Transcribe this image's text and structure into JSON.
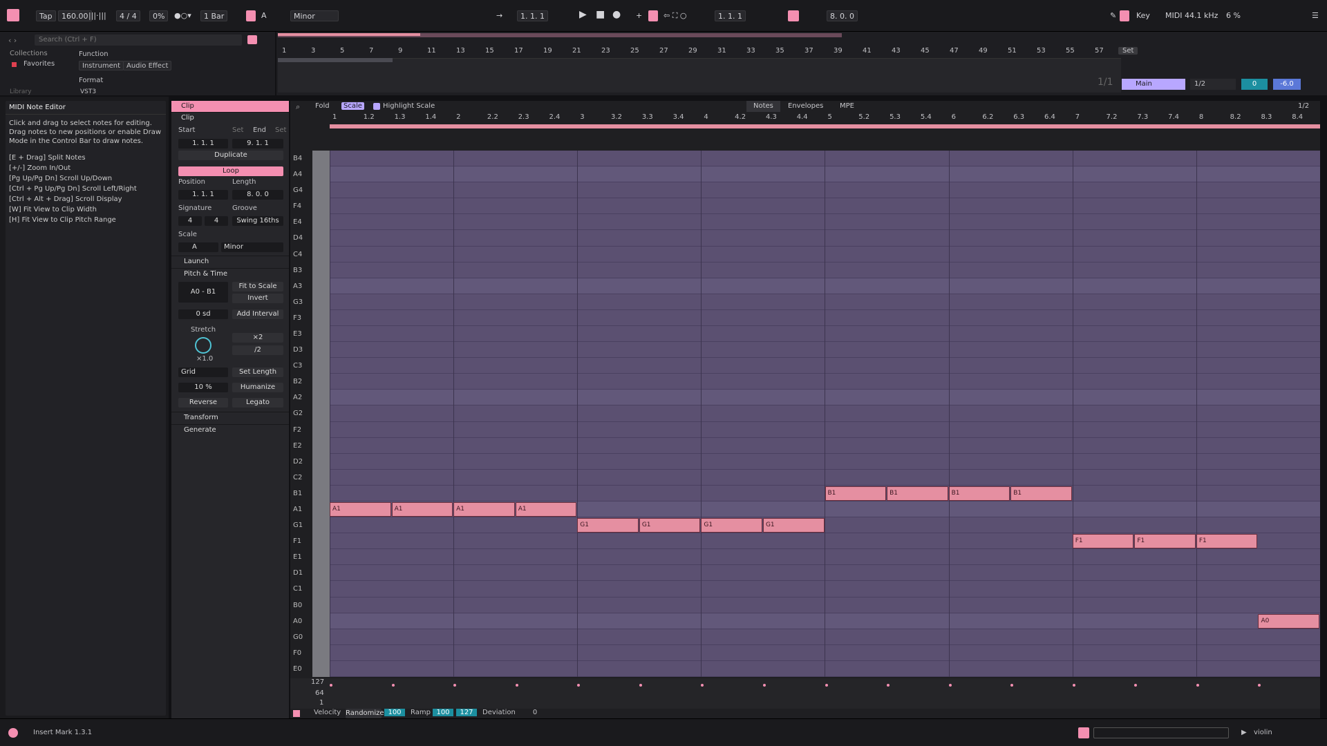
{
  "transport": {
    "tap": "Tap",
    "tempo": "160.00",
    "sig": "4 / 4",
    "swing": "0%",
    "quant": "1 Bar",
    "key": "A",
    "scale": "Minor",
    "pos": "1.  1.  1",
    "loop_start": "1.  1.  1",
    "loop_len": "8.  0.  0",
    "key_label": "Key",
    "midi_label": "MIDI",
    "sample_rate": "44.1 kHz",
    "cpu": "6 %"
  },
  "browser": {
    "search_placeholder": "Search (Ctrl + F)",
    "collections": "Collections",
    "favorites": "Favorites",
    "function": "Function",
    "instrument": "Instrument",
    "audio_effect": "Audio Effect",
    "format": "Format",
    "vst3": "VST3",
    "library": "Library"
  },
  "arrangement": {
    "ruler": [
      "1",
      "3",
      "5",
      "7",
      "9",
      "11",
      "13",
      "15",
      "17",
      "19",
      "21",
      "23",
      "25",
      "27",
      "29",
      "31",
      "33",
      "35",
      "37",
      "39",
      "41",
      "43",
      "45",
      "47",
      "49",
      "51",
      "53",
      "55",
      "57"
    ],
    "set": "Set",
    "fraction": "1/1",
    "track": "Main",
    "quant": "1/2",
    "vol": "0",
    "pan": "-6.0"
  },
  "help": {
    "title": "MIDI Note Editor",
    "body": "Click and drag to select notes for editing. Drag notes to new positions or enable Draw Mode in the Control Bar to draw notes.",
    "shortcuts": [
      "[E + Drag] Split Notes",
      "[+/-] Zoom In/Out",
      "[Pg Up/Pg Dn] Scroll Up/Down",
      "[Ctrl + Pg Up/Pg Dn] Scroll Left/Right",
      "[Ctrl + Alt + Drag] Scroll Display",
      "[W] Fit View to Clip Width",
      "[H] Fit View to Clip Pitch Range"
    ]
  },
  "clip": {
    "title": "Clip",
    "sub": "Clip",
    "start": "Start",
    "end": "End",
    "set": "Set",
    "start_val": "1.   1.   1",
    "end_val": "9.   1.   1",
    "duplicate": "Duplicate",
    "loop": "Loop",
    "position": "Position",
    "length": "Length",
    "pos_val": "1.   1.   1",
    "len_val": "8.   0.   0",
    "signature": "Signature",
    "groove": "Groove",
    "sig_num": "4",
    "sig_den": "4",
    "groove_val": "Swing 16ths",
    "scale_lbl": "Scale",
    "scale_key": "A",
    "scale_mode": "Minor",
    "launch": "Launch",
    "pitch_time": "Pitch & Time",
    "range": "A0 - B1",
    "fit_scale": "Fit to Scale",
    "invert": "Invert",
    "sd": "0 sd",
    "add_interval": "Add Interval",
    "stretch": "Stretch",
    "x2": "×2",
    "half": "/2",
    "stretch_val": "×1.0",
    "grid": "Grid",
    "set_length": "Set Length",
    "humanize_val": "10 %",
    "humanize": "Humanize",
    "reverse": "Reverse",
    "legato": "Legato",
    "transform": "Transform",
    "generate": "Generate"
  },
  "editor": {
    "fold": "Fold",
    "scale": "Scale",
    "highlight": "Highlight Scale",
    "tabs": [
      "Notes",
      "Envelopes",
      "MPE"
    ],
    "grid_quant": "1/2",
    "ruler": [
      "1",
      "1.2",
      "1.3",
      "1.4",
      "2",
      "2.2",
      "2.3",
      "2.4",
      "3",
      "3.2",
      "3.3",
      "3.4",
      "4",
      "4.2",
      "4.3",
      "4.4",
      "5",
      "5.2",
      "5.3",
      "5.4",
      "6",
      "6.2",
      "6.3",
      "6.4",
      "7",
      "7.2",
      "7.3",
      "7.4",
      "8",
      "8.2",
      "8.3",
      "8.4"
    ],
    "keys": [
      "B4",
      "A4",
      "G4",
      "F4",
      "E4",
      "D4",
      "C4",
      "B3",
      "A3",
      "G3",
      "F3",
      "E3",
      "D3",
      "C3",
      "B2",
      "A2",
      "G2",
      "F2",
      "E2",
      "D2",
      "C2",
      "B1",
      "A1",
      "G1",
      "F1",
      "E1",
      "D1",
      "C1",
      "B0",
      "A0",
      "G0",
      "F0",
      "E0"
    ],
    "vel_top": "127",
    "vel_mid": "64",
    "vel_bot": "1",
    "velocity": "Velocity",
    "randomize": "Randomize",
    "rand_val": "100",
    "ramp": "Ramp",
    "ramp_a": "100",
    "ramp_b": "127",
    "deviation": "Deviation",
    "dev_val": "0"
  },
  "notes": [
    {
      "p": "A1",
      "s": 0
    },
    {
      "p": "A1",
      "s": 1
    },
    {
      "p": "A1",
      "s": 2
    },
    {
      "p": "A1",
      "s": 3
    },
    {
      "p": "G1",
      "s": 4
    },
    {
      "p": "G1",
      "s": 5
    },
    {
      "p": "G1",
      "s": 6
    },
    {
      "p": "G1",
      "s": 7
    },
    {
      "p": "B1",
      "s": 8
    },
    {
      "p": "B1",
      "s": 9
    },
    {
      "p": "B1",
      "s": 10
    },
    {
      "p": "B1",
      "s": 11
    },
    {
      "p": "F1",
      "s": 12
    },
    {
      "p": "F1",
      "s": 13
    },
    {
      "p": "F1",
      "s": 14
    },
    {
      "p": "A0",
      "s": 15
    }
  ],
  "status": {
    "text": "Insert Mark 1.3.1",
    "track": "violin"
  }
}
